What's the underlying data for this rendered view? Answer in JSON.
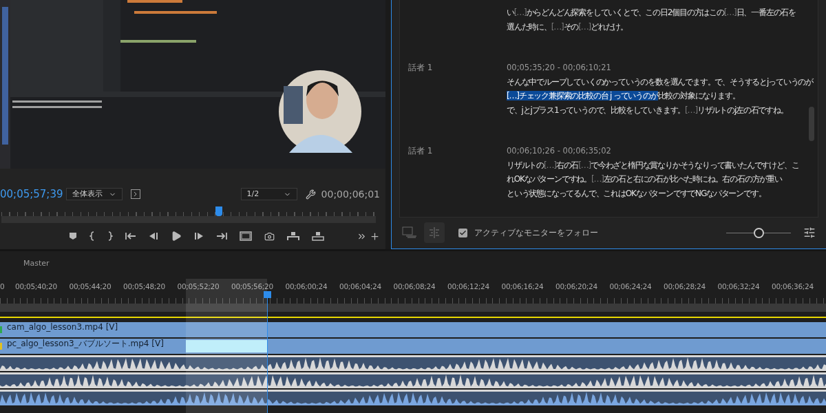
{
  "program_monitor": {
    "timecode": "00;05;57;39",
    "zoom_select": {
      "value": "全体表示"
    },
    "resolution_select": {
      "value": "1/2"
    },
    "duration": "00;00;06;01",
    "playhead": {
      "level": 0.58
    }
  },
  "transcript": {
    "entries": [
      {
        "lines": [
          [
            {
              "kind": "word",
              "text": "い"
            },
            {
              "kind": "gap",
              "text": "[…]"
            },
            {
              "kind": "word",
              "text": "からどんどん探索をしていくとで、この日2個目の方はこの"
            },
            {
              "kind": "gap",
              "text": "[…]"
            },
            {
              "kind": "word",
              "text": "日、一番左の石を"
            }
          ],
          [
            {
              "kind": "word",
              "text": "選んだ時に、"
            },
            {
              "kind": "gap",
              "text": "[…]"
            },
            {
              "kind": "word",
              "text": "その"
            },
            {
              "kind": "gap",
              "text": "[…]"
            },
            {
              "kind": "word",
              "text": "どれだけ。"
            }
          ]
        ]
      },
      {
        "speaker": "話者 1",
        "time": "00;05;35;20 - 00;06;10;21",
        "lines": [
          [
            {
              "kind": "word",
              "text": "そんな中でループしていくのかっていうのを数を選んでます。で、そうするとjっていうのが"
            }
          ],
          [
            {
              "kind": "highlight",
              "text": "[…]チェック兼探索の比較の台 j っていうのが"
            },
            {
              "kind": "word",
              "text": "比較の対象になります。"
            }
          ],
          [
            {
              "kind": "word",
              "text": "で、jとjプラス1っていうので、比較をしていきます。"
            },
            {
              "kind": "gap",
              "text": "[…]"
            },
            {
              "kind": "word",
              "text": "リザルトのj左の石ですね。"
            }
          ]
        ]
      },
      {
        "speaker": "話者 1",
        "time": "00;06;10;26 - 00;06;35;02",
        "lines": [
          [
            {
              "kind": "word",
              "text": "リザルトの"
            },
            {
              "kind": "gap",
              "text": "[…]"
            },
            {
              "kind": "word",
              "text": "右の石"
            },
            {
              "kind": "gap",
              "text": "[…]"
            },
            {
              "kind": "word",
              "text": "で今わざと楕円な賞なりかそうなりって書いたんですけど、こ"
            }
          ],
          [
            {
              "kind": "word",
              "text": "れOKなパターンですね。"
            },
            {
              "kind": "gap",
              "text": "[…]"
            },
            {
              "kind": "word",
              "text": "左の石と右にの石が比べた時にね。右の石の方が重い"
            }
          ],
          [
            {
              "kind": "word",
              "text": "という状態になってるんで、これはOKなパターンですでNGなパターンです。"
            }
          ]
        ]
      }
    ],
    "follow_monitor": {
      "label": "アクティブなモニターをフォロー",
      "checked": true
    },
    "zoom_slider": {
      "level": 0.5
    }
  },
  "timeline": {
    "title": "Master",
    "ruler_labels": [
      "0",
      "00;05;40;20",
      "00;05;44;20",
      "00;05;48;20",
      "00;05;52;20",
      "00;05;56;20",
      "00;06;00;24",
      "00;06;04;24",
      "00;06;08;24",
      "00;06;12;24",
      "00;06;16;24",
      "00;06;20;24",
      "00;06;24;24",
      "00;06;28;24",
      "00;06;32;24",
      "00;06;36;24"
    ],
    "playhead": {
      "level": 0.323
    },
    "tracks": [
      {
        "kind": "video",
        "label": "cam_algo_lesson3.mp4 [V]",
        "color": "#2fa84f"
      },
      {
        "kind": "video",
        "label": "pc_algo_lesson3_バブルソート.mp4 [V]",
        "color": "#e0c020"
      },
      {
        "kind": "audio",
        "color": "#d8d8d8"
      },
      {
        "kind": "audio",
        "color": "#d8d8d8"
      },
      {
        "kind": "audio",
        "color": "#7aa6e0"
      }
    ]
  }
}
